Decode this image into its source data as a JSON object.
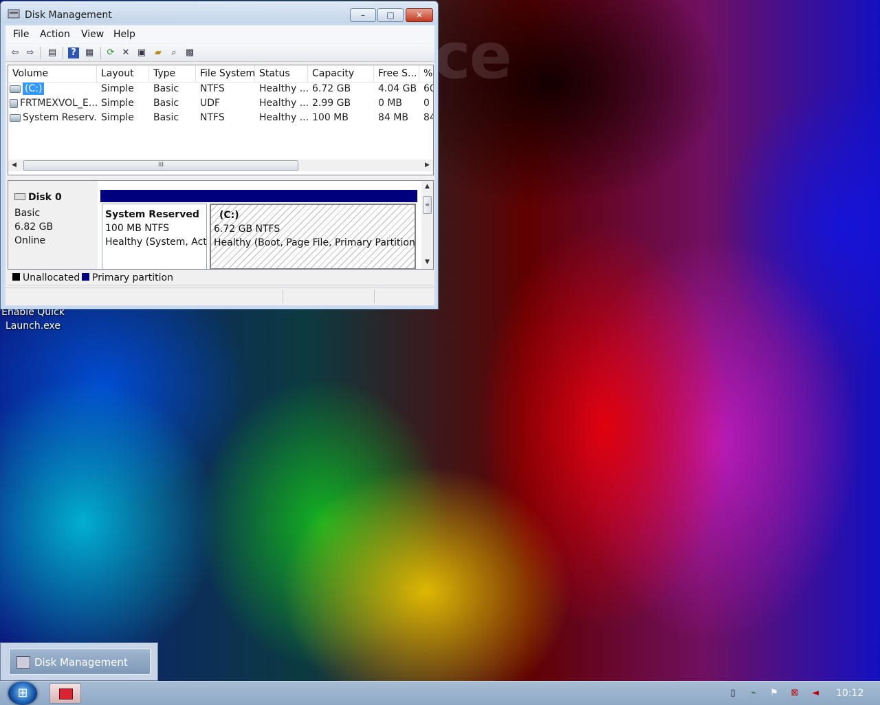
{
  "desktop": {
    "logo_text": "ce",
    "icon_label": "Enable Quick Launch.exe"
  },
  "window": {
    "title": "Disk Management",
    "buttons": {
      "minimize": "–",
      "maximize": "□",
      "close": "✕"
    }
  },
  "menu": [
    "File",
    "Action",
    "View",
    "Help"
  ],
  "toolbar": [
    "back-icon",
    "forward-icon",
    "console-tree-icon",
    "help-icon",
    "show-pane-icon",
    "refresh-icon",
    "delete-icon",
    "properties-icon",
    "open-icon",
    "explore-icon",
    "settings-icon"
  ],
  "volumes": {
    "columns": [
      "Volume",
      "Layout",
      "Type",
      "File System",
      "Status",
      "Capacity",
      "Free S...",
      "%"
    ],
    "rows": [
      [
        "(C:)",
        "Simple",
        "Basic",
        "NTFS",
        "Healthy ...",
        "6.72 GB",
        "4.04 GB",
        "60"
      ],
      [
        "FRTMEXVOL_E...",
        "Simple",
        "Basic",
        "UDF",
        "Healthy ...",
        "2.99 GB",
        "0 MB",
        "0 '"
      ],
      [
        "System Reserv...",
        "Simple",
        "Basic",
        "NTFS",
        "Healthy ...",
        "100 MB",
        "84 MB",
        "84"
      ]
    ],
    "scroll_grip": "III"
  },
  "disk": {
    "name": "Disk 0",
    "type": "Basic",
    "size": "6.82 GB",
    "status": "Online",
    "partitions": [
      {
        "title": "System Reserved",
        "size": "100 MB NTFS",
        "status": "Healthy (System, Acti"
      },
      {
        "title": "(C:)",
        "size": "6.72 GB NTFS",
        "status": "Healthy (Boot, Page File, Primary Partition)"
      }
    ]
  },
  "legend": {
    "unallocated": "Unallocated",
    "primary": "Primary partition",
    "colors": {
      "unallocated": "#000000",
      "primary": "#00007f"
    }
  },
  "taskbar": {
    "popup_label": "Disk Management",
    "clock": "10:12"
  }
}
